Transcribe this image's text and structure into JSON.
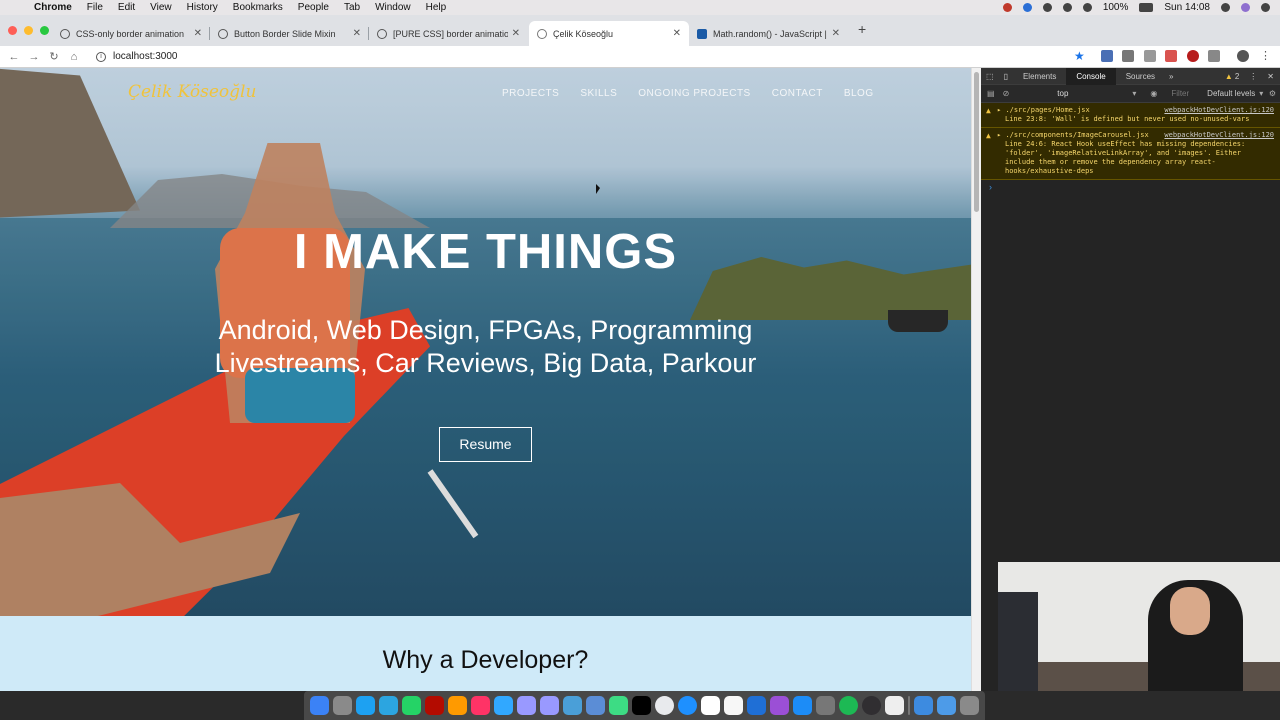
{
  "menubar": {
    "app": "Chrome",
    "items": [
      "File",
      "Edit",
      "View",
      "History",
      "Bookmarks",
      "People",
      "Tab",
      "Window",
      "Help"
    ],
    "battery": "100%",
    "clock": "Sun 14:08"
  },
  "tabs": [
    {
      "title": "CSS-only border animation",
      "active": false
    },
    {
      "title": "Button Border Slide Mixin",
      "active": false
    },
    {
      "title": "[PURE CSS] border animation w",
      "active": false
    },
    {
      "title": "Çelik Köseoğlu",
      "active": true
    },
    {
      "title": "Math.random() - JavaScript | MD",
      "active": false
    }
  ],
  "toolbar": {
    "url": "localhost:3000"
  },
  "page": {
    "brand": "Çelik Köseoğlu",
    "nav": [
      "PROJECTS",
      "SKILLS",
      "ONGOING PROJECTS",
      "CONTACT",
      "BLOG"
    ],
    "headline": "I MAKE THINGS",
    "subline1": "Android, Web Design, FPGAs, Programming",
    "subline2": "Livestreams, Car Reviews, Big Data, Parkour",
    "resume_button": "Resume",
    "section_title": "Why a Developer?"
  },
  "devtools": {
    "tabs": [
      "Elements",
      "Console",
      "Sources"
    ],
    "active_tab": "Console",
    "warning_count": "2",
    "context": "top",
    "filter_placeholder": "Filter",
    "levels": "Default levels",
    "messages": [
      {
        "file": "./src/pages/Home.jsx",
        "source": "webpackHotDevClient.js:120",
        "text": "Line 23:8:  'Wall' is defined but never used  no-unused-vars"
      },
      {
        "file": "./src/components/ImageCarousel.jsx",
        "source": "webpackHotDevClient.js:120",
        "text": "Line 24:6:  React Hook useEffect has missing dependencies: 'folder', 'imageRelativeLinkArray', and 'images'. Either include them or remove the dependency array  react-hooks/exhaustive-deps"
      }
    ]
  },
  "colors": {
    "brand_yellow": "#f0c33c",
    "kayak_red": "#e8432a",
    "section_bg": "#cfeaf8",
    "warn_bg": "#332b00",
    "warn_text": "#f5d66b"
  }
}
